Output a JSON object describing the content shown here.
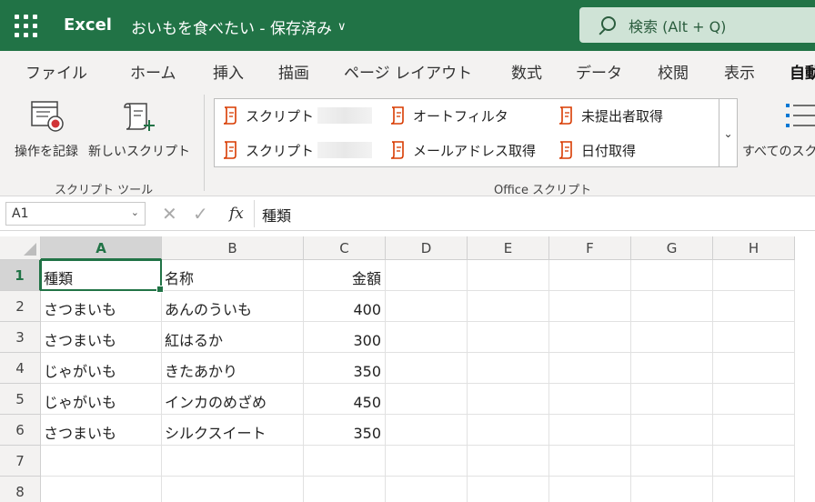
{
  "app": {
    "name": "Excel",
    "doc_title": "おいもを食べたい - 保存済み"
  },
  "search": {
    "label": "検索 (Alt + Q)"
  },
  "menu": {
    "tabs": [
      {
        "label": "ファイル"
      },
      {
        "label": "ホーム"
      },
      {
        "label": "挿入"
      },
      {
        "label": "描画"
      },
      {
        "label": "ページ レイアウト"
      },
      {
        "label": "数式"
      },
      {
        "label": "データ"
      },
      {
        "label": "校閲"
      },
      {
        "label": "表示"
      },
      {
        "label": "自動"
      }
    ]
  },
  "ribbon": {
    "record_label": "操作を記録",
    "new_script_label": "新しいスクリプト",
    "group1_label": "スクリプト ツール",
    "group2_label": "Office スクリプト",
    "all_scripts_label": "すべてのスク",
    "scripts": [
      {
        "label": "スクリプト"
      },
      {
        "label": "オートフィルタ"
      },
      {
        "label": "未提出者取得"
      },
      {
        "label": "スクリプト"
      },
      {
        "label": "メールアドレス取得"
      },
      {
        "label": "日付取得"
      }
    ]
  },
  "formula": {
    "name_box": "A1",
    "fx": "fx",
    "content": "種類"
  },
  "sheet": {
    "columns": [
      "A",
      "B",
      "C",
      "D",
      "E",
      "F",
      "G",
      "H"
    ],
    "rows": [
      "1",
      "2",
      "3",
      "4",
      "5",
      "6",
      "7",
      "8"
    ],
    "cells": [
      [
        "種類",
        "名称",
        "金額"
      ],
      [
        "さつまいも",
        "あんのういも",
        "400"
      ],
      [
        "さつまいも",
        "紅はるか",
        "300"
      ],
      [
        "じゃがいも",
        "きたあかり",
        "350"
      ],
      [
        "じゃがいも",
        "インカのめざめ",
        "450"
      ],
      [
        "さつまいも",
        "シルクスイート",
        "350"
      ],
      [
        "",
        "",
        ""
      ],
      [
        "",
        "",
        ""
      ]
    ],
    "selected": "A1"
  },
  "colors": {
    "brand": "#217346",
    "search_bg": "#cfe3d6",
    "script_icon": "#d83b01"
  }
}
